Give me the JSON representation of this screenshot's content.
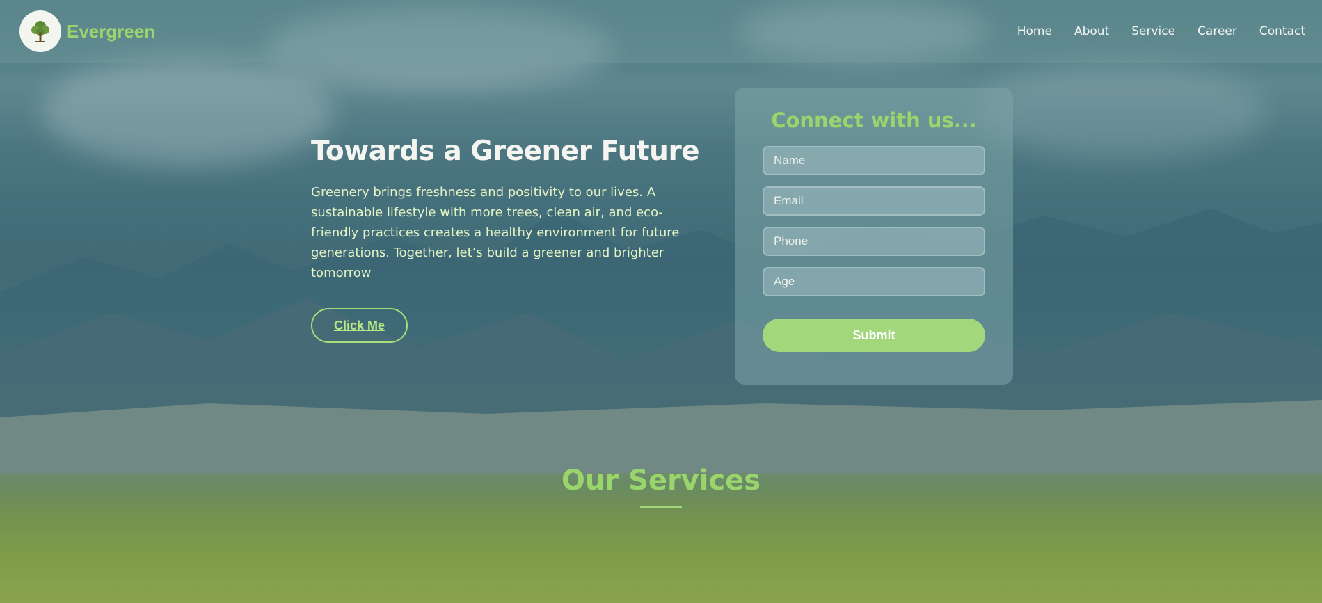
{
  "header": {
    "brand": "Evergreen",
    "logo_icon": "tree-icon",
    "nav": [
      "Home",
      "About",
      "Service",
      "Career",
      "Contact"
    ]
  },
  "hero": {
    "title": "Towards a Greener Future",
    "text": "Greenery brings freshness and positivity to our lives. A sustainable lifestyle with more trees, clean air, and eco-friendly practices creates a healthy environment for future generations. Together, let’s build a greener and brighter tomorrow",
    "cta_label": "Click Me"
  },
  "form": {
    "title": "Connect with us...",
    "fields": [
      {
        "placeholder": "Name",
        "value": ""
      },
      {
        "placeholder": "Email",
        "value": ""
      },
      {
        "placeholder": "Phone",
        "value": ""
      },
      {
        "placeholder": "Age",
        "value": ""
      }
    ],
    "submit_label": "Submit"
  },
  "services": {
    "title": "Our Services"
  },
  "colors": {
    "accent": "#9ad46d",
    "button": "#a3d77c",
    "hero_text": "#e4f3c4"
  }
}
